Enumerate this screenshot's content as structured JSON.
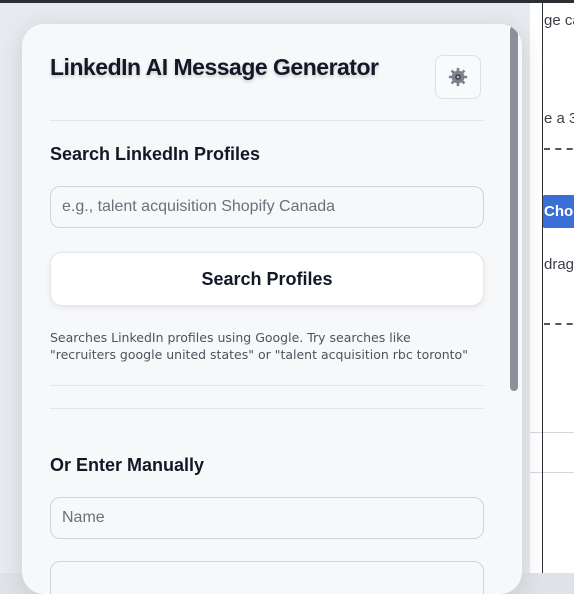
{
  "background": {
    "snippets": [
      "ge ca",
      "e a 3",
      "Cho",
      "drag"
    ]
  },
  "popup": {
    "title": "LinkedIn AI Message Generator",
    "settings_icon": "gear-icon"
  },
  "search_section": {
    "title": "Search LinkedIn Profiles",
    "query_placeholder": "e.g., talent acquisition Shopify Canada",
    "query_value": "",
    "search_button_label": "Search Profiles",
    "hint": "Searches LinkedIn profiles using Google. Try searches like \"recruiters google united states\" or \"talent acquisition rbc toronto\""
  },
  "manual_section": {
    "title": "Or Enter Manually",
    "name_placeholder": "Name",
    "name_value": ""
  },
  "colors": {
    "accent": "#3b6fd8",
    "text": "#121826",
    "popup_bg": "#f7f8fa"
  }
}
